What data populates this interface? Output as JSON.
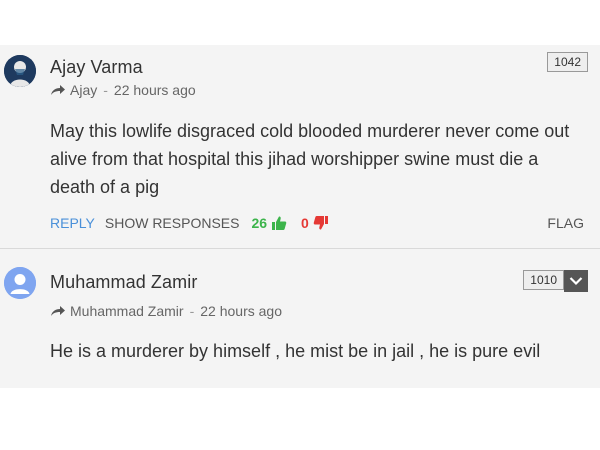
{
  "comments": [
    {
      "author": "Ajay Varma",
      "reply_to": "Ajay",
      "time": "22 hours ago",
      "separator": "-",
      "score": "1042",
      "text": "May this lowlife disgraced cold blooded murderer never come out alive from that hospital this jihad worshipper swine must die a death of a pig",
      "actions": {
        "reply": "REPLY",
        "show_responses": "SHOW RESPONSES",
        "upvotes": "26",
        "downvotes": "0",
        "flag": "FLAG"
      }
    },
    {
      "author": "Muhammad Zamir",
      "reply_to": "Muhammad Zamir",
      "time": "22 hours ago",
      "separator": "-",
      "score": "1010",
      "text": "He is a murderer by himself , he mist be in jail , he is pure evil"
    }
  ],
  "icons": {
    "share": "share-arrow-icon",
    "thumb_up": "thumb-up-icon",
    "thumb_down": "thumb-down-icon",
    "collapse": "chevron-down-icon"
  },
  "colors": {
    "reply": "#4a90d9",
    "upvote": "#3cb44b",
    "downvote": "#e53935",
    "panel_background": "#f4f4f4"
  }
}
